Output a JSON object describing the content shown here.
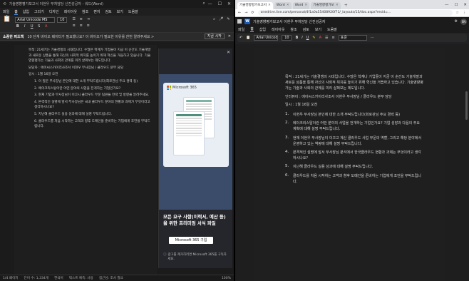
{
  "left": {
    "window_title": "기술영향평가보고서 이현우 부처담당 신진성공자 - 워드(Word)",
    "menu": [
      "파일",
      "홈",
      "삽입",
      "그리기",
      "디자인",
      "레이아웃",
      "참조",
      "편지",
      "검토",
      "보기",
      "도움말"
    ],
    "active_menu": "홈",
    "font_name": "Arial Unicode MS",
    "font_size": "10",
    "infobar": {
      "title": "소중한 피드백",
      "message": "10 단계 바이오 웨이터가 필요했나요? 이 바이오가 필요한 이유를 한번 알려주세요 >",
      "button": "지금 시작"
    },
    "paragraphs": [
      "목적: 21세기는 기술경쟁의 시대입니다. 수많은 학계가 기업들이 지금 이 순간도 기술개발과 새로운 상품을 통해 자신의 사회적 위치를 높이기 위해 혁신을 거듭하고 있습니다. 기술영향평가는 기술과 사회의 관계를 미리 살펴보는 제도입니다.",
      "담당자 : 에이씨스카이리사조서 이현우 부사장님 / 클라우드 분부 담당",
      "일시 : 1월 16일 오전",
      "1.  이 질문 부사장님 본인에 대한 소개 부탁드립니다(회로관님 주요 경력 등)",
      "2.  에이크리스탈이란 어떤 분야의 사업을 전개하는 기업인가요?",
      "3.  현재 기업과 부사장님이 이끄시 클라우드 부문 팀원들 전략 및 방향을 알려주세요.",
      "4.  본격적인 설명에 앞서 부사장님은 국내 클라우드 분야의 현황과 과제가 무엇이라고 생각하시나요?",
      "5.  지난해 클라우드 실용 성과에 대해 설명 부탁드립니다.",
      "6.  클라우드를 처음 시작하는 고객과 향후 도메인을 준비하는 기업에게 조언을 부탁드립니다."
    ],
    "status": {
      "page": "1/4 페이지",
      "words": "단어 수: 1,334개",
      "lang": "한국어",
      "predict": "텍스트 예측: 사용",
      "access": "접근성: 조사 필요",
      "zoom": "100%"
    },
    "ad": {
      "brand": "Microsoft 365",
      "headline": "모든 요구 사항(이력서, 예산 등)을 위한 프리미엄 서식 파일",
      "cta": "Microsoft 365 구입",
      "note": "광고를 제거하려면 Microsoft 365를 구독하세요."
    }
  },
  "right": {
    "tabs": [
      "기술영향평가보고서",
      "Word",
      "Word",
      "기술영향평가보"
    ],
    "url": "onedrive.live.com/personal/4f1a0a55408920f71/_layouts/15/doc.aspx?resid=...",
    "app_title": "기술영향평가보고서 이현우 부처담당 신진성공자",
    "app_badge": "W",
    "avatar_text": "SN",
    "menu": [
      "파일",
      "홈",
      "삽입",
      "레이아웃",
      "참조",
      "검토",
      "보기",
      "도움말"
    ],
    "active_menu": "홈",
    "font_name": "Arial Unicod...",
    "font_size": "10",
    "style_name": "표준",
    "paragraphs": [
      "목적 : 21세기는 기술경쟁의 시대입니다. 수많은 학계나 기업들이 지금 이 순간도 기술개발과 새로운 상품을 통해 자신의 사회적 위치를 높이기 위해 혁신을 거듭하고 있습니다. 기술영향평가는 기술과 사회의 관계를 미리 살펴보는 제도입니다.",
      "인터뷰이 : 에이씨스카이리사조서 이현우 부사장님 / 클라우드 분부 담당",
      "일시 : 1월 16일 오전"
    ],
    "items": [
      "이현우 부사장님 본인에 대한 소개 부탁드립니다(회로관님 주요 경력 등)",
      "에이크리스탈이란 어떤 분야의 사업을 전개하는 기업인가요? 기업 성장과 다음의 주요 계획에 대해 설명 부탁드립니다.",
      "현재 이현우 부사장님이 이끄고 계신 클라우드 사업 부문의 역할, 그리고 해당 분야에서 운영하고 있는 역량에 대해 설명 부탁드립니다.",
      "본격적인 설명에 앞서 부사장님 분석에서 한국클라우드 현황과 과제는 무엇이라고 생각하시나요?",
      "지난해 클라우드 실용 성과에 대해 설명 부탁드립니다.",
      "클라우드를 처음 시작하는 고객과 향후 도메인을 준비하는 기업에게 조언을 부탁드립니다."
    ]
  }
}
